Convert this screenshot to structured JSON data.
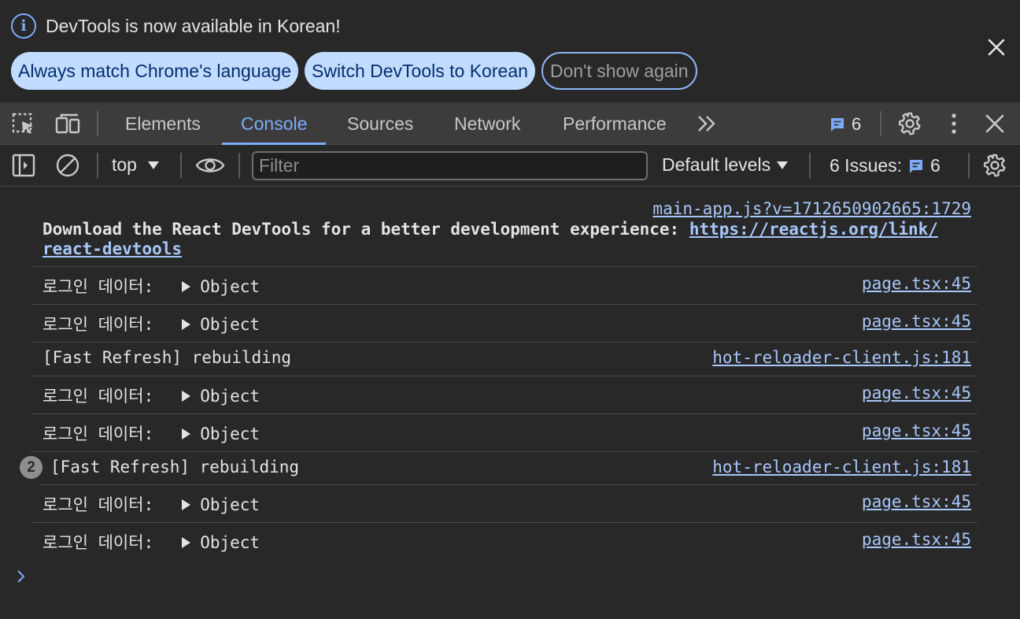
{
  "infobar": {
    "message": "DevTools is now available in Korean!",
    "buttons": {
      "match_language": "Always match Chrome's language",
      "switch_korean": "Switch DevTools to Korean",
      "dont_show": "Don't show again"
    }
  },
  "tabs": [
    {
      "label": "Elements"
    },
    {
      "label": "Console",
      "active": true
    },
    {
      "label": "Sources"
    },
    {
      "label": "Network"
    },
    {
      "label": "Performance"
    }
  ],
  "toolbar": {
    "issues_badge_count": "6"
  },
  "console_toolbar": {
    "context": "top",
    "filter_placeholder": "Filter",
    "levels": "Default levels",
    "issues_label": "6 Issues:",
    "issues_count": "6"
  },
  "messages": [
    {
      "source": "main-app.js?v=1712650902665:1729",
      "text": "Download the React DevTools for a better development experience: ",
      "link_part1": "https://reactjs.org/link/",
      "link_part2": "react-devtools"
    },
    {
      "label": "로그인 데이터:",
      "value": "Object",
      "source": "page.tsx:45"
    },
    {
      "label": "로그인 데이터:",
      "value": "Object",
      "source": "page.tsx:45"
    },
    {
      "text": "[Fast Refresh] rebuilding",
      "source": "hot-reloader-client.js:181"
    },
    {
      "label": "로그인 데이터:",
      "value": "Object",
      "source": "page.tsx:45"
    },
    {
      "label": "로그인 데이터:",
      "value": "Object",
      "source": "page.tsx:45"
    },
    {
      "repeat": "2",
      "text": "[Fast Refresh] rebuilding",
      "source": "hot-reloader-client.js:181"
    },
    {
      "label": "로그인 데이터:",
      "value": "Object",
      "source": "page.tsx:45"
    },
    {
      "label": "로그인 데이터:",
      "value": "Object",
      "source": "page.tsx:45"
    }
  ],
  "colors": {
    "accent": "#7cacf8",
    "link": "#a8c7fa",
    "background": "#282828",
    "toolbar": "#3c3c3c"
  }
}
